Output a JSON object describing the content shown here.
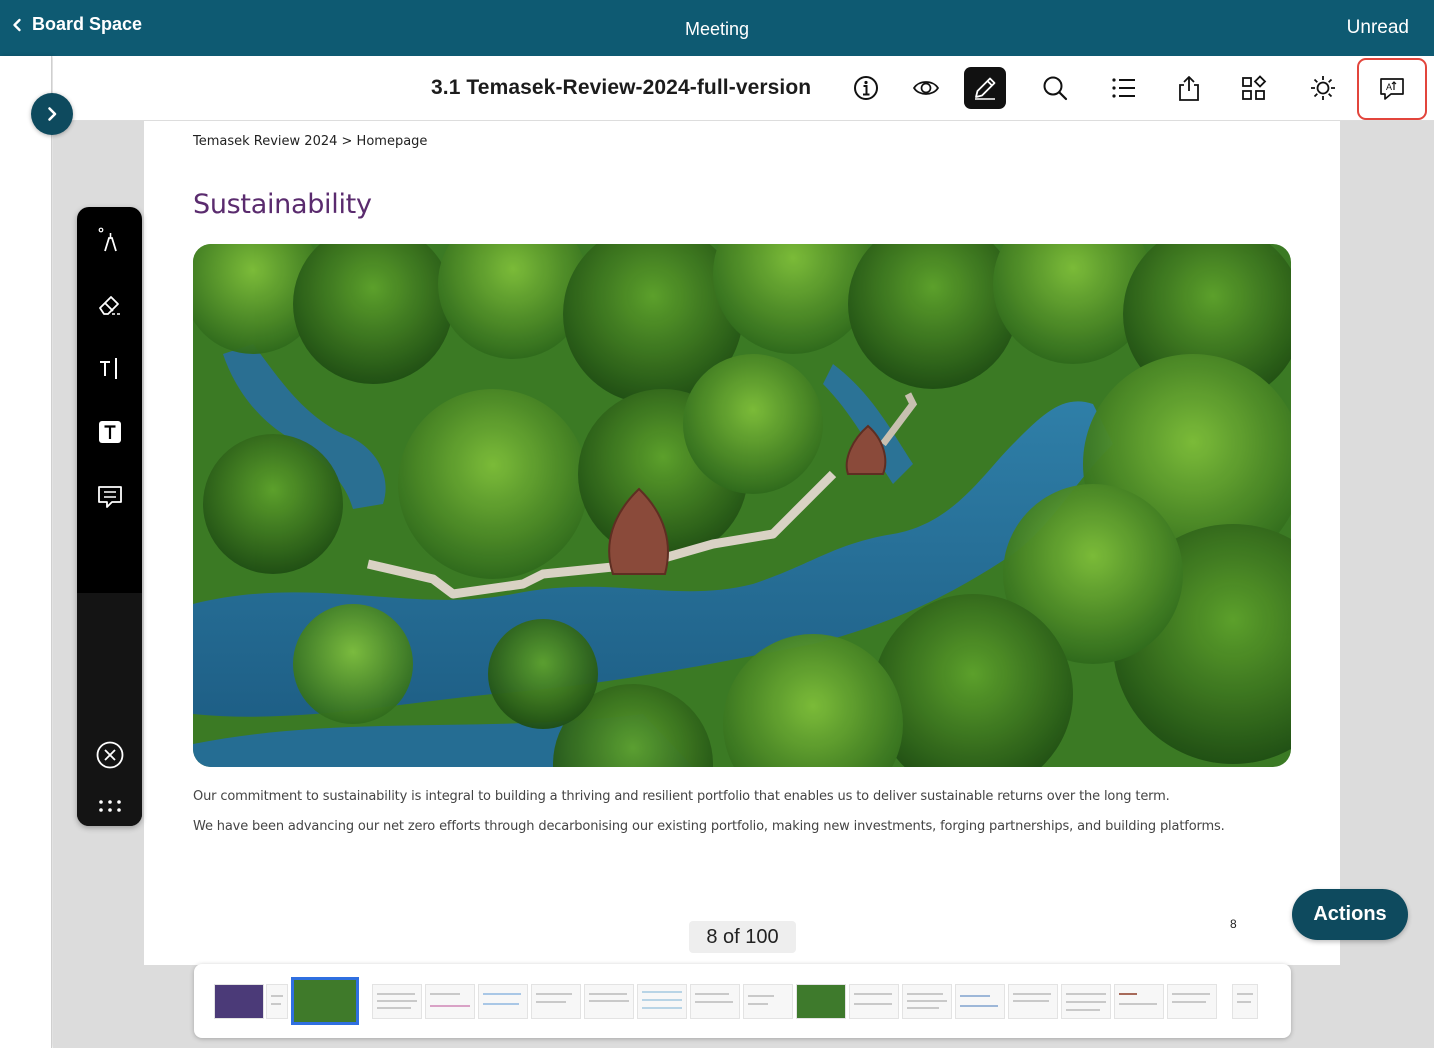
{
  "topbar": {
    "back_label": "Board Space",
    "title": "Meeting",
    "unread_label": "Unread"
  },
  "toolbar": {
    "doc_title": "3.1 Temasek-Review-2024-full-version",
    "icons": [
      "info-icon",
      "eye-icon",
      "pencil-icon",
      "search-icon",
      "list-icon",
      "share-icon",
      "apps-icon",
      "brightness-icon",
      "translate-icon"
    ],
    "active_icon": "pencil-icon",
    "highlighted_icon": "translate-icon"
  },
  "page": {
    "breadcrumb": "Temasek Review 2024 > Homepage",
    "heading": "Sustainability",
    "paragraph_1": "Our commitment to sustainability is integral to building a thriving and resilient portfolio that enables us to deliver sustainable returns over the long term.",
    "paragraph_2": "We have been advancing our net zero efforts through decarbonising our existing portfolio, making new investments, forging partnerships, and building platforms.",
    "page_number": "8"
  },
  "pager": {
    "label": "8 of 100"
  },
  "palette": {
    "tools": [
      "pen-icon",
      "eraser-icon",
      "text-cursor-icon",
      "text-box-icon",
      "comment-icon"
    ],
    "close": "close-circle-icon",
    "more": "more-dots-icon"
  },
  "actions_label": "Actions",
  "colors": {
    "topbar": "#0e5a72",
    "accent": "#0e4a5e",
    "heading": "#5a2b6e",
    "highlight": "#e2453c",
    "thumb_selected": "#2f6fe0"
  }
}
